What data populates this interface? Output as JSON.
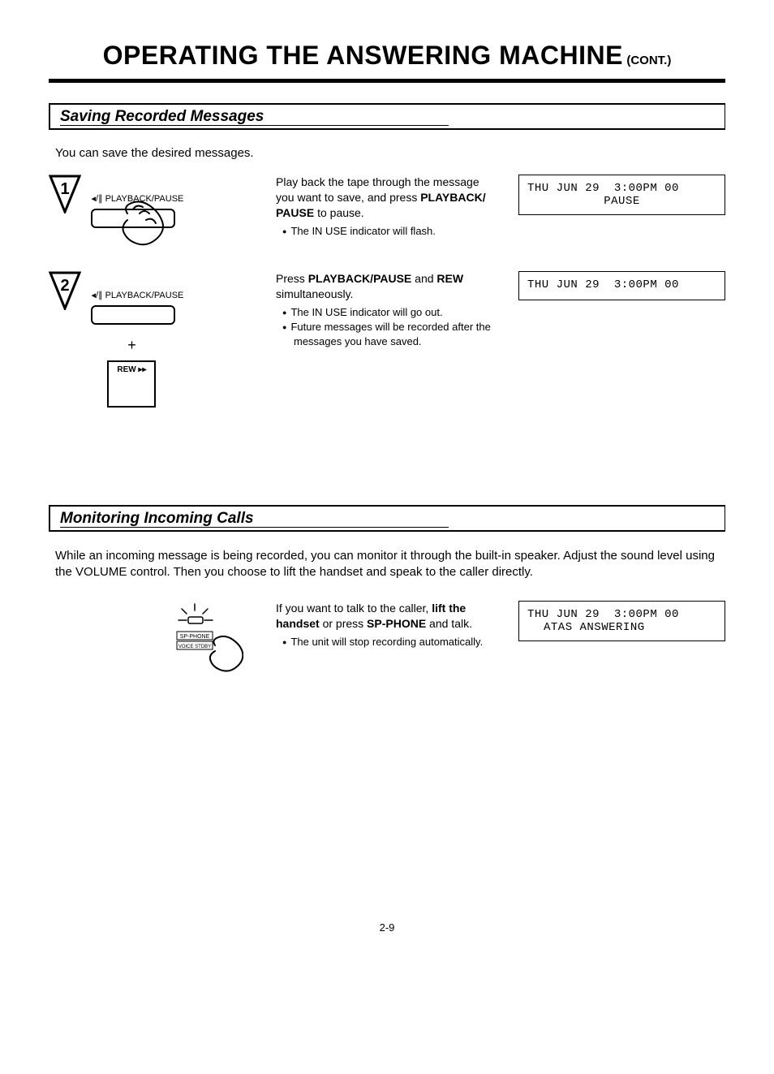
{
  "title": {
    "main": "OPERATING THE ANSWERING MACHINE",
    "cont": "(CONT.)"
  },
  "section1": {
    "header": "Saving Recorded Messages",
    "intro": "You can save the desired messages.",
    "step1": {
      "num": "1",
      "button_label": "◂/∥ PLAYBACK/PAUSE",
      "text_pre": "Play back the tape through the message you want to save, and press ",
      "text_bold": "PLAYBACK/ PAUSE",
      "text_post": " to pause.",
      "bullets": [
        "The IN USE indicator will flash."
      ],
      "display_line1": "THU JUN 29  3:00PM 00",
      "display_line2": "PAUSE"
    },
    "step2": {
      "num": "2",
      "button_label": "◂/∥ PLAYBACK/PAUSE",
      "plus": "+",
      "rew_label": "REW ▸▸",
      "text_pre": "Press ",
      "text_bold1": "PLAYBACK/PAUSE",
      "text_mid": " and ",
      "text_bold2": "REW",
      "text_post": " simultaneously.",
      "bullets": [
        "The IN USE indicator will go out.",
        "Future messages will be recorded after the messages you have saved."
      ],
      "display_line1": "THU JUN 29  3:00PM 00",
      "display_line2": ""
    }
  },
  "section2": {
    "header": "Monitoring Incoming Calls",
    "intro": "While an incoming message is being recorded, you can monitor it through the built-in speaker. Adjust the sound level using the VOLUME control. Then you choose to lift the handset and speak to the caller directly.",
    "sp_phone_label": "SP-PHONE",
    "voice_stdby_label": "VOICE STDBY",
    "text_pre": "If you want to talk to the caller, ",
    "text_bold1": "lift the handset",
    "text_mid": " or press ",
    "text_bold2": "SP-PHONE",
    "text_post": " and talk.",
    "bullets": [
      "The unit will stop recording automatically."
    ],
    "display_line1": "THU JUN 29  3:00PM 00",
    "display_line2": "ATAS ANSWERING"
  },
  "page_num": "2-9"
}
